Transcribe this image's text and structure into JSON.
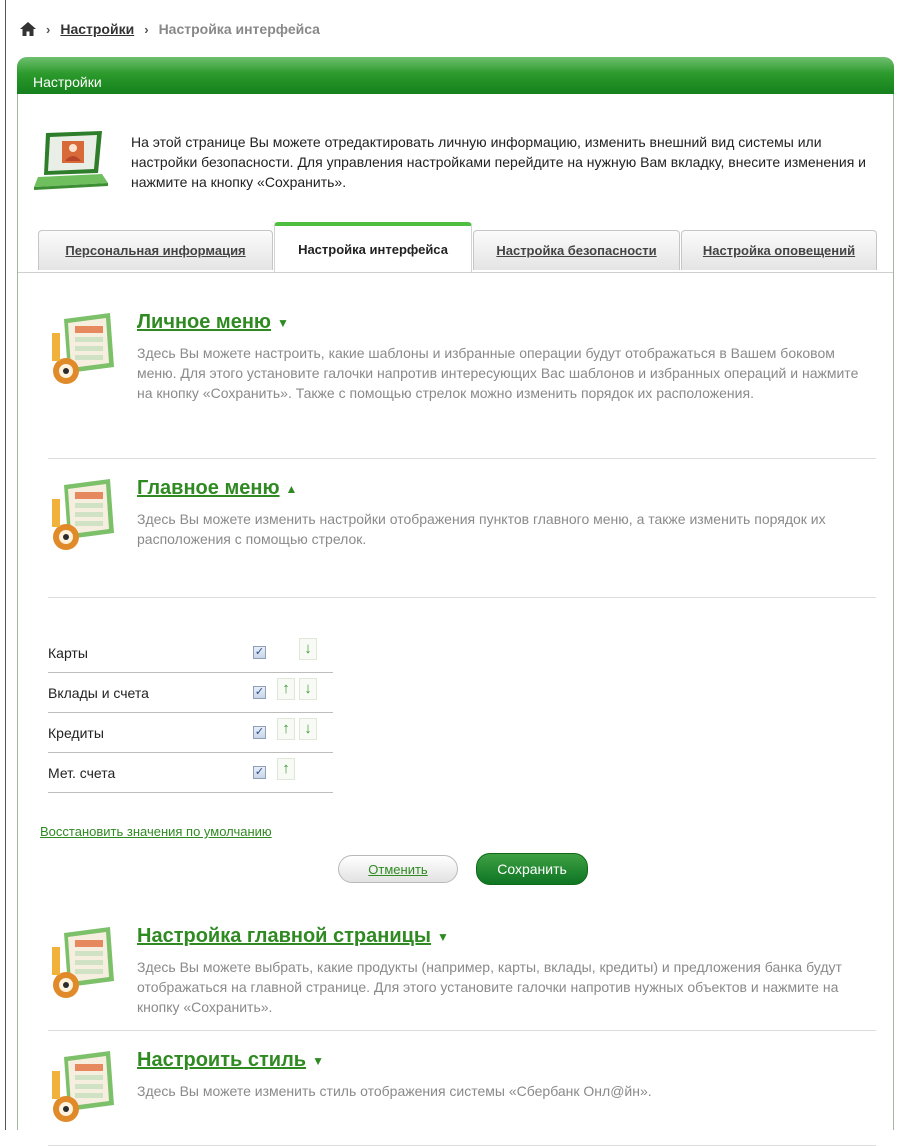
{
  "breadcrumb": {
    "home_icon": "home-icon",
    "sep1": "›",
    "settings_link": "Настройки",
    "sep2": "›",
    "current": "Настройка интерфейса"
  },
  "panel": {
    "header": "Настройки",
    "intro_text": "На этой странице Вы можете отредактировать личную информацию, изменить внешний вид системы или настройки безопасности. Для управления настройками перейдите на нужную Вам вкладку, внесите изменения и нажмите на кнопку «Сохранить»."
  },
  "tabs": [
    {
      "label": "Персональная информация",
      "active": false
    },
    {
      "label": "Настройка интерфейса",
      "active": true
    },
    {
      "label": "Настройка безопасности",
      "active": false
    },
    {
      "label": "Настройка оповещений",
      "active": false
    }
  ],
  "sections": [
    {
      "title": "Личное меню",
      "caret": "▼",
      "description": "Здесь Вы можете настроить, какие шаблоны и избранные операции будут отображаться в Вашем боковом меню. Для этого установите галочки напротив интересующих Вас шаблонов и избранных операций и нажмите на кнопку «Сохранить». Также с помощью стрелок можно изменить порядок их расположения."
    },
    {
      "title": "Главное меню",
      "caret": "▲",
      "description": "Здесь Вы можете изменить настройки отображения пунктов главного меню, а также изменить порядок их расположения с помощью стрелок."
    },
    {
      "title": "Настройка главной страницы",
      "caret": "▼",
      "description": "Здесь Вы можете выбрать, какие продукты (например, карты, вклады, кредиты) и предложения банка будут отображаться на главной странице. Для этого установите галочки напротив нужных объектов и нажмите на кнопку «Сохранить»."
    },
    {
      "title": "Настроить стиль",
      "caret": "▼",
      "description": "Здесь Вы можете изменить стиль отображения системы «Сбербанк Онл@йн»."
    }
  ],
  "main_menu_items": [
    {
      "label": "Карты",
      "checked": true,
      "check_glyph": "✓",
      "up": "",
      "down": "↓"
    },
    {
      "label": "Вклады и счета",
      "checked": true,
      "check_glyph": "✓",
      "up": "↑",
      "down": "↓"
    },
    {
      "label": "Кредиты",
      "checked": true,
      "check_glyph": "✓",
      "up": "↑",
      "down": "↓"
    },
    {
      "label": "Мет. счета",
      "checked": true,
      "check_glyph": "✓",
      "up": "↑",
      "down": ""
    }
  ],
  "actions": {
    "restore_link": "Восстановить значения по умолчанию",
    "cancel": "Отменить",
    "save": "Сохранить"
  },
  "colors": {
    "accent_green": "#2f8a22",
    "header_green": "#15801d",
    "save_button": "#0e7524"
  }
}
